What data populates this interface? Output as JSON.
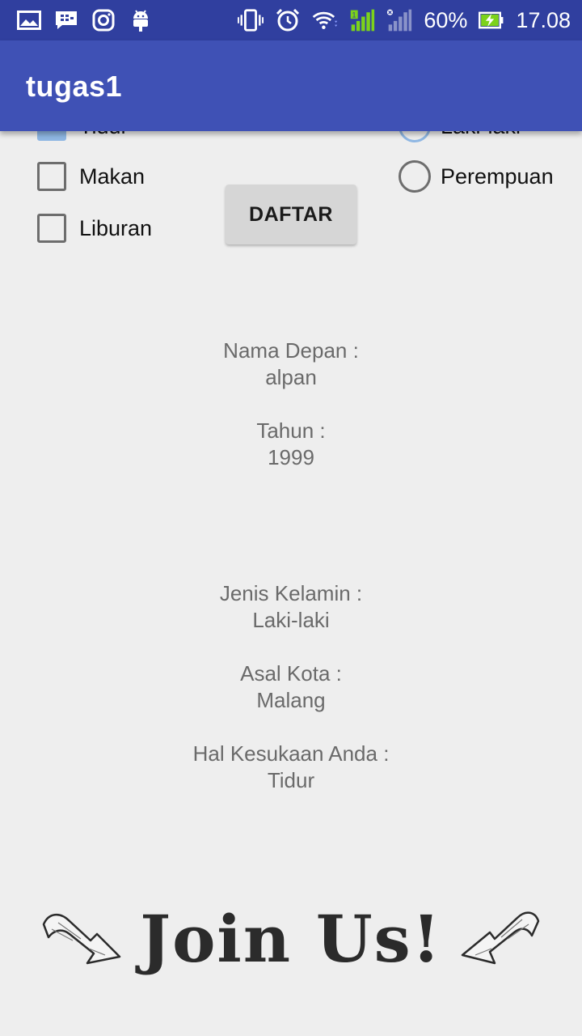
{
  "status_bar": {
    "battery_percent": "60%",
    "time": "17.08",
    "icons_left": [
      "image-icon",
      "bbm-icon",
      "instagram-icon",
      "android-icon"
    ],
    "icons_right": [
      "vibrate-icon",
      "alarm-icon",
      "wifi-icon",
      "signal-sim1-icon",
      "signal-sim2-icon",
      "battery-charging-icon"
    ]
  },
  "app_bar": {
    "title": "tugas1"
  },
  "form": {
    "checkboxes": [
      {
        "label": "Tidur",
        "checked": true
      },
      {
        "label": "Makan",
        "checked": false
      },
      {
        "label": "Liburan",
        "checked": false
      }
    ],
    "radios": [
      {
        "label": "Laki-laki",
        "checked": true
      },
      {
        "label": "Perempuan",
        "checked": false
      }
    ],
    "submit_label": "DAFTAR"
  },
  "result": {
    "nama_label": "Nama Depan :",
    "nama_value": "alpan",
    "tahun_label": "Tahun :",
    "tahun_value": "1999",
    "jenis_label": "Jenis Kelamin :",
    "jenis_value": "Laki-laki",
    "kota_label": "Asal Kota :",
    "kota_value": "Malang",
    "hal_label": "Hal Kesukaan Anda :",
    "hal_value": "Tidur"
  },
  "banner": {
    "text": "Join Us!"
  },
  "colors": {
    "status_bar": "#303f9f",
    "app_bar": "#3f51b5",
    "checked": "#8fb7e3"
  }
}
